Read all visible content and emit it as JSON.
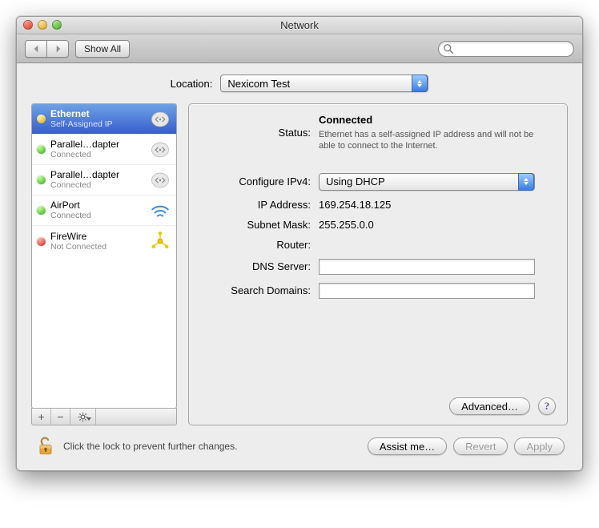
{
  "window": {
    "title": "Network"
  },
  "toolbar": {
    "show_all_label": "Show All",
    "search_placeholder": ""
  },
  "location": {
    "label": "Location:",
    "value": "Nexicom Test"
  },
  "sidebar": {
    "items": [
      {
        "name": "Ethernet",
        "status": "Self-Assigned IP",
        "dot": "yellow",
        "icon": "ethernet",
        "selected": true
      },
      {
        "name": "Parallel…dapter",
        "status": "Connected",
        "dot": "green",
        "icon": "ethernet"
      },
      {
        "name": "Parallel…dapter",
        "status": "Connected",
        "dot": "green",
        "icon": "ethernet"
      },
      {
        "name": "AirPort",
        "status": "Connected",
        "dot": "green",
        "icon": "airport"
      },
      {
        "name": "FireWire",
        "status": "Not Connected",
        "dot": "red",
        "icon": "firewire"
      }
    ],
    "buttons": {
      "add": "+",
      "remove": "−",
      "gear": "gear"
    }
  },
  "detail": {
    "labels": {
      "status": "Status:",
      "configure": "Configure IPv4:",
      "ip": "IP Address:",
      "subnet": "Subnet Mask:",
      "router": "Router:",
      "dns": "DNS Server:",
      "search": "Search Domains:"
    },
    "status_value": "Connected",
    "status_sub": "Ethernet has a self-assigned IP address and will not be able to connect to the Internet.",
    "configure_value": "Using DHCP",
    "ip_value": "169.254.18.125",
    "subnet_value": "255.255.0.0",
    "router_value": "",
    "dns_value": "",
    "search_value": "",
    "advanced_label": "Advanced…"
  },
  "footer": {
    "lock_text": "Click the lock to prevent further changes.",
    "assist_label": "Assist me…",
    "revert_label": "Revert",
    "apply_label": "Apply"
  }
}
